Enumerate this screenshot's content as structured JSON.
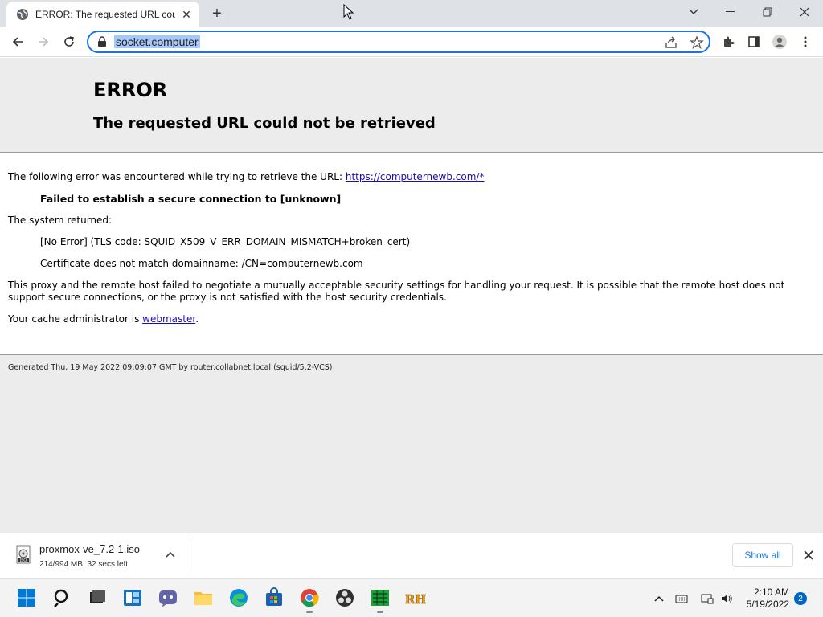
{
  "tab": {
    "title": "ERROR: The requested URL could not be retrieved",
    "favicon": "globe-icon",
    "close": "✕"
  },
  "newtab": {
    "label": "+"
  },
  "toolbar": {
    "url": "socket.computer"
  },
  "page": {
    "h1": "ERROR",
    "h2": "The requested URL could not be retrieved",
    "intro_text": "The following error was encountered while trying to retrieve the URL:",
    "intro_link": "https://computernewb.com/*",
    "failure": "Failed to establish a secure connection to [unknown]",
    "system_returned": "The system returned:",
    "error_code": "[No Error] (TLS code: SQUID_X509_V_ERR_DOMAIN_MISMATCH+broken_cert)",
    "cert_message": "Certificate does not match domainname: /CN=computernewb.com",
    "explanation": "This proxy and the remote host failed to negotiate a mutually acceptable security settings for handling your request. It is possible that the remote host does not support secure connections, or the proxy is not satisfied with the host security credentials.",
    "admin_prefix": "Your cache administrator is",
    "admin_link": "webmaster",
    "admin_suffix": ".",
    "footer": "Generated Thu, 19 May 2022 09:09:07 GMT by router.collabnet.local (squid/5.2-VCS)"
  },
  "download": {
    "filename": "proxmox-ve_7.2-1.iso",
    "status": "214/994 MB, 32 secs left",
    "show_all": "Show all"
  },
  "taskbar": {
    "time": "2:10 AM",
    "date": "5/19/2022",
    "notifications": "2"
  },
  "colors": {
    "accent": "#1a73e8",
    "link": "#1a0dab",
    "chrome_frame": "#dee1e6"
  }
}
